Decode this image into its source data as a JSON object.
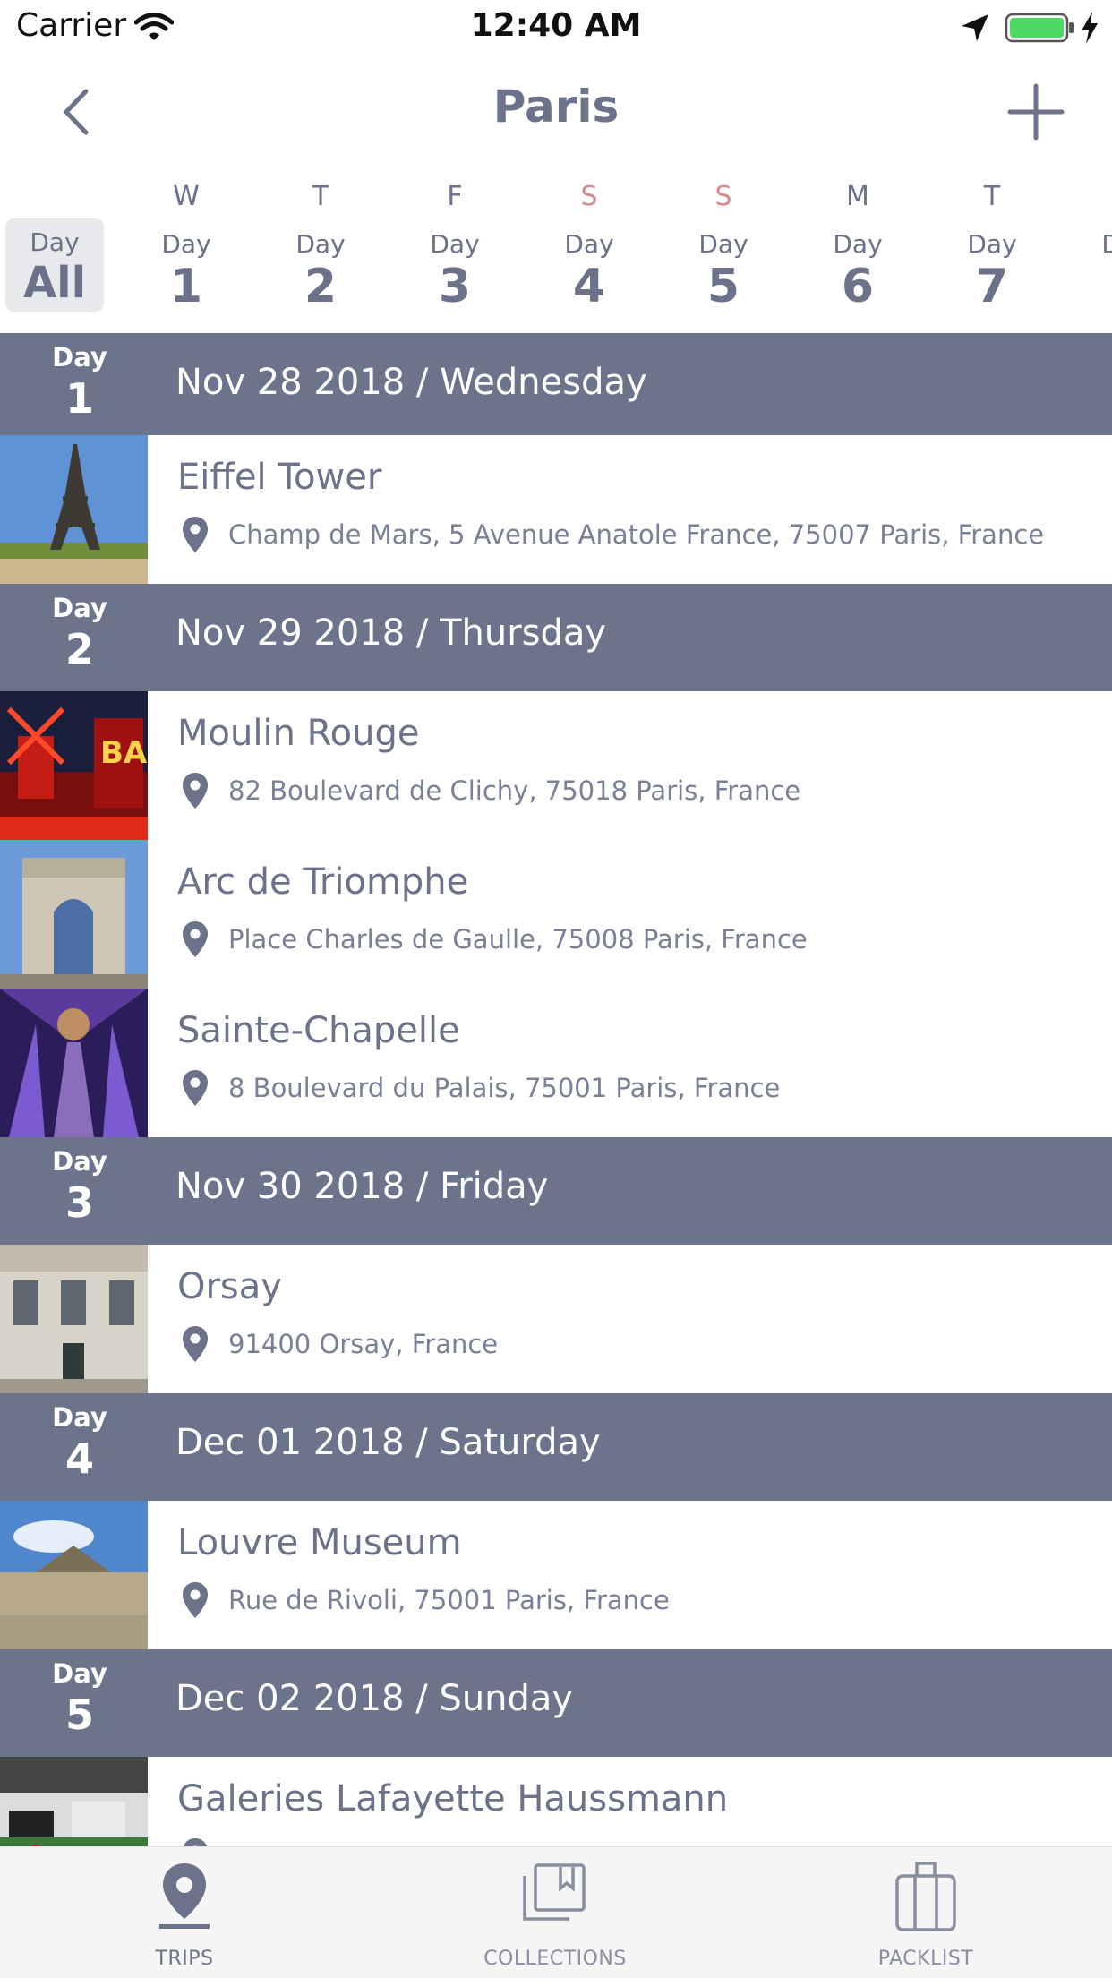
{
  "status_bar": {
    "carrier": "Carrier",
    "time": "12:40 AM"
  },
  "nav": {
    "title": "Paris"
  },
  "day_selector": {
    "all": {
      "label": "Day",
      "value": "All"
    },
    "days": [
      {
        "weekday": "W",
        "label": "Day",
        "number": "1",
        "weekend": false
      },
      {
        "weekday": "T",
        "label": "Day",
        "number": "2",
        "weekend": false
      },
      {
        "weekday": "F",
        "label": "Day",
        "number": "3",
        "weekend": false
      },
      {
        "weekday": "S",
        "label": "Day",
        "number": "4",
        "weekend": true
      },
      {
        "weekday": "S",
        "label": "Day",
        "number": "5",
        "weekend": true
      },
      {
        "weekday": "M",
        "label": "Day",
        "number": "6",
        "weekend": false
      },
      {
        "weekday": "T",
        "label": "Day",
        "number": "7",
        "weekend": false
      },
      {
        "weekday": "",
        "label": "Day",
        "number": "",
        "weekend": false
      }
    ]
  },
  "itinerary": [
    {
      "label": "Day",
      "number": "1",
      "date": "Nov 28 2018 / Wednesday",
      "places": [
        {
          "name": "Eiffel Tower",
          "address": "Champ de Mars, 5 Avenue Anatole France, 75007 Paris, France",
          "thumb": "eiffel"
        }
      ]
    },
    {
      "label": "Day",
      "number": "2",
      "date": "Nov 29 2018 / Thursday",
      "places": [
        {
          "name": "Moulin Rouge",
          "address": "82 Boulevard de Clichy, 75018 Paris, France",
          "thumb": "moulin"
        },
        {
          "name": "Arc de Triomphe",
          "address": "Place Charles de Gaulle, 75008 Paris, France",
          "thumb": "arc"
        },
        {
          "name": "Sainte-Chapelle",
          "address": "8 Boulevard du Palais, 75001 Paris, France",
          "thumb": "chapelle"
        }
      ]
    },
    {
      "label": "Day",
      "number": "3",
      "date": "Nov 30 2018 / Friday",
      "places": [
        {
          "name": "Orsay",
          "address": "91400 Orsay, France",
          "thumb": "orsay"
        }
      ]
    },
    {
      "label": "Day",
      "number": "4",
      "date": "Dec 01 2018 / Saturday",
      "places": [
        {
          "name": "Louvre Museum",
          "address": "Rue de Rivoli, 75001 Paris, France",
          "thumb": "louvre"
        }
      ]
    },
    {
      "label": "Day",
      "number": "5",
      "date": "Dec 02 2018 / Sunday",
      "places": [
        {
          "name": "Galeries Lafayette Haussmann",
          "address": "",
          "thumb": "lafayette"
        }
      ]
    }
  ],
  "tabbar": {
    "tabs": [
      {
        "label": "TRIPS",
        "icon": "map-pin-icon",
        "active": true
      },
      {
        "label": "COLLECTIONS",
        "icon": "bookmark-stack-icon",
        "active": false
      },
      {
        "label": "PACKLIST",
        "icon": "suitcase-icon",
        "active": false
      }
    ]
  },
  "colors": {
    "accent": "#6c748c",
    "weekend": "#d98a8f",
    "text": "#6b7289"
  }
}
